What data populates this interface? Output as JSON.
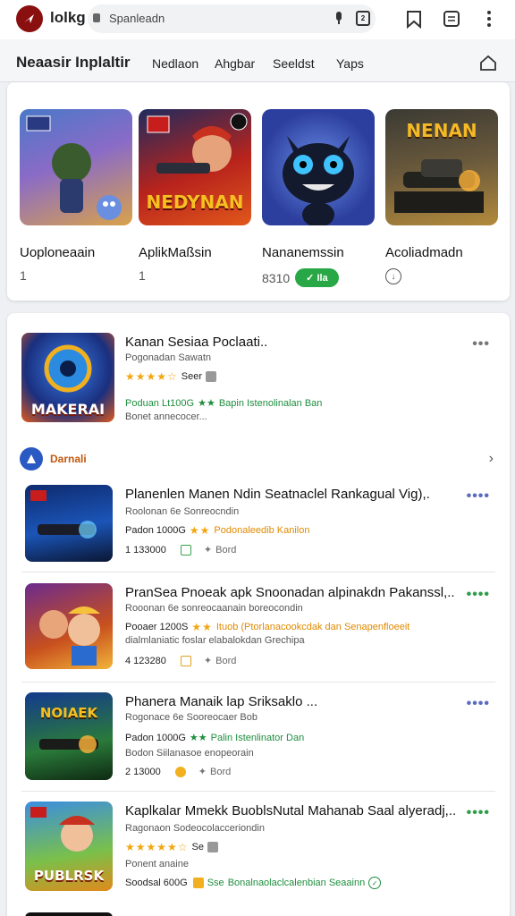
{
  "header": {
    "app_name": "lolkg",
    "search_placeholder": "Spanleadn",
    "icons": [
      "lock-icon",
      "mic-icon",
      "qr-icon",
      "bookmark-icon",
      "tabs-icon",
      "menu-icon"
    ]
  },
  "tabs": {
    "section_title": "Neaasir Inplaltir",
    "items": [
      "Nedlaon",
      "Ahgbar",
      "Seeldst",
      "Yaps"
    ]
  },
  "featured": [
    {
      "title": "Uoploneaain",
      "meta": "1",
      "art_label": "",
      "colors": [
        "#4a78c8",
        "#d9a24a"
      ]
    },
    {
      "title": "AplikMaßsin",
      "meta": "1",
      "art_label": "NEDYNAN",
      "colors": [
        "#b8231c",
        "#1f2b5e"
      ]
    },
    {
      "title": "Nananemssin",
      "meta": "8310",
      "action": "Ila",
      "art_label": "",
      "colors": [
        "#2d3f9e",
        "#3b5fd0"
      ]
    },
    {
      "title": "Acoliadmadn",
      "meta": "",
      "art_label": "NENAN",
      "colors": [
        "#3b3a33",
        "#b28a3c"
      ]
    }
  ],
  "list": {
    "top_item": {
      "title": "Kanan Sesiaa Poclaati..",
      "sub": "Pogonadan Sawatn",
      "rating_text": "Seer",
      "line2_a": "Poduan Lt100G",
      "line2_b": "Bapin Istenolinalan Ban",
      "line3": "Bonet annecocer...",
      "art_label": "MAKERAI"
    },
    "section_label": "Darnali",
    "items": [
      {
        "title": "Planenlen Manen Ndin Seatnaclel Rankagual Vig),.",
        "sub": "Roolonan 6e Sonreocndin",
        "line2_a": "Padon 1000G",
        "line2_b": "Podonaleedib Kanilon",
        "line3_a": "1  133000",
        "line3_b": "Bord",
        "art_label": ""
      },
      {
        "title": "PranSea Pnoeak apk Snoonadan alpinakdn Pakanssl,..",
        "sub": "Rooonan 6e sonreocaanain boreocondin",
        "line2_a": "Pooaer 1200S",
        "line2_b": "Ituob (Ptorlanacookcdak dan Senapenfloeeit",
        "line3": "dialmlaniatic foslar elabalokdan Grechipa",
        "line4_a": "4  123280",
        "line4_b": "Bord",
        "art_label": ""
      },
      {
        "title": "Phanera Manaik lap Sriksaklo ...",
        "sub": "Rogonace 6e Sooreocaer Bob",
        "line2_a": "Padon 1000G",
        "line2_b": "Palin Istenlinator Dan",
        "line3": "Bodon Siilanasoe enopeorain",
        "line4_a": "2  13000",
        "line4_b": "Bord",
        "art_label": "NOIAEK"
      },
      {
        "title": "Kaplkalar Mmekk BuoblsNutal Mahanab Saal alyeradj,..",
        "sub": "Ragonaon Sodeocolacceriondin",
        "rating_text": "Se",
        "line3": "Ponent anaine",
        "line4_a": "Soodsal 600G",
        "line4_b": "Bonalnaolaclcalenbian Seaainn",
        "line4_c": "Sse",
        "art_label": "PUBLRSK"
      }
    ]
  },
  "colors": {
    "accent_green": "#27a745",
    "link_green": "#1e8e3e",
    "rating_orange": "#f2a60f",
    "logo_red": "#8a0f0f"
  }
}
